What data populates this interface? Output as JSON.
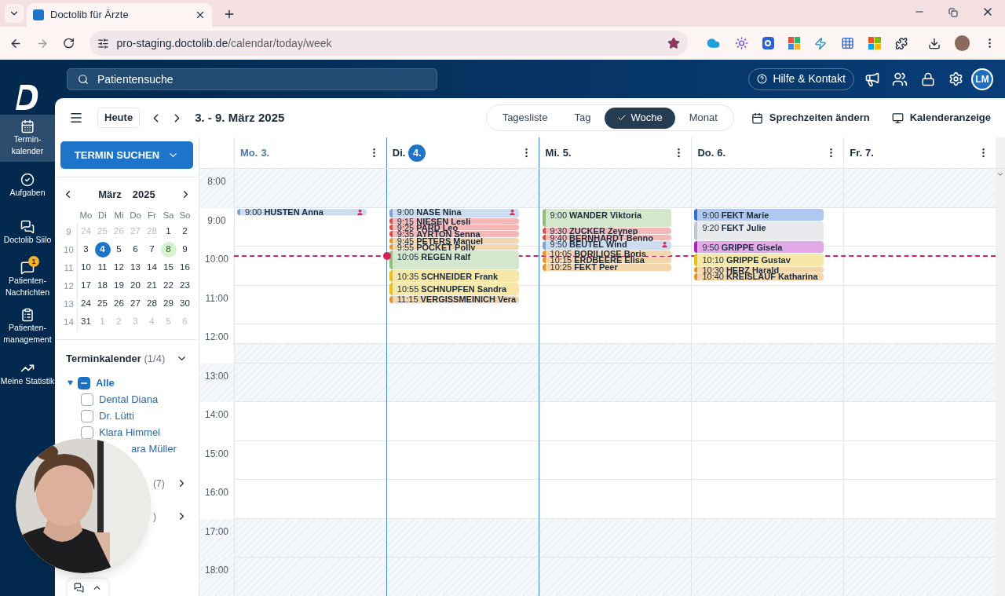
{
  "browser": {
    "tab_title": "Doctolib für Ärzte",
    "url_host": "pro-staging.doctolib.de",
    "url_path": "/calendar/today/week"
  },
  "header": {
    "search_placeholder": "Patientensuche",
    "help_button": "Hilfe & Kontakt",
    "avatar_initials": "LM"
  },
  "nav": [
    {
      "label": "Termin-\nkalender",
      "selected": true
    },
    {
      "label": "Aufgaben",
      "selected": false
    },
    {
      "label": "Doctolib Siilo",
      "selected": false
    },
    {
      "label": "Patienten-\nNachrichten",
      "selected": false,
      "badge": "1"
    },
    {
      "label": "Patienten-\nmanagement",
      "selected": false
    },
    {
      "label": "Meine Statistik",
      "selected": false
    }
  ],
  "toolbar": {
    "today_button": "Heute",
    "range": "3. - 9. März 2025",
    "views": [
      {
        "label": "Tagesliste",
        "selected": false
      },
      {
        "label": "Tag",
        "selected": false
      },
      {
        "label": "Woche",
        "selected": true
      },
      {
        "label": "Monat",
        "selected": false
      }
    ],
    "actions": [
      "Sprechzeiten ändern",
      "Kalenderanzeige"
    ]
  },
  "left_panel": {
    "search_button": "TERMIN SUCHEN",
    "mini_calendar": {
      "month": "März",
      "year": "2025",
      "weekdays": [
        "Mo",
        "Di",
        "Mi",
        "Do",
        "Fr",
        "Sa",
        "So"
      ],
      "weeks": [
        {
          "number": "9",
          "days": [
            {
              "t": "24",
              "muted": true,
              "selected": false,
              "marked": false
            },
            {
              "t": "25",
              "muted": true,
              "selected": false,
              "marked": false
            },
            {
              "t": "26",
              "muted": true,
              "selected": false,
              "marked": false
            },
            {
              "t": "27",
              "muted": true,
              "selected": false,
              "marked": false
            },
            {
              "t": "28",
              "muted": true,
              "selected": false,
              "marked": false
            },
            {
              "t": "1",
              "muted": false,
              "selected": false,
              "marked": false
            },
            {
              "t": "2",
              "muted": false,
              "selected": false,
              "marked": false
            }
          ]
        },
        {
          "number": "10",
          "days": [
            {
              "t": "3",
              "muted": false,
              "selected": false,
              "marked": false
            },
            {
              "t": "4",
              "muted": false,
              "selected": true,
              "marked": false
            },
            {
              "t": "5",
              "muted": false,
              "selected": false,
              "marked": false
            },
            {
              "t": "6",
              "muted": false,
              "selected": false,
              "marked": false
            },
            {
              "t": "7",
              "muted": false,
              "selected": false,
              "marked": false
            },
            {
              "t": "8",
              "muted": false,
              "selected": false,
              "marked": true
            },
            {
              "t": "9",
              "muted": false,
              "selected": false,
              "marked": false
            }
          ]
        },
        {
          "number": "11",
          "days": [
            {
              "t": "10",
              "muted": false,
              "selected": false,
              "marked": false
            },
            {
              "t": "11",
              "muted": false,
              "selected": false,
              "marked": false
            },
            {
              "t": "12",
              "muted": false,
              "selected": false,
              "marked": false
            },
            {
              "t": "13",
              "muted": false,
              "selected": false,
              "marked": false
            },
            {
              "t": "14",
              "muted": false,
              "selected": false,
              "marked": false
            },
            {
              "t": "15",
              "muted": false,
              "selected": false,
              "marked": false
            },
            {
              "t": "16",
              "muted": false,
              "selected": false,
              "marked": false
            }
          ]
        },
        {
          "number": "12",
          "days": [
            {
              "t": "17",
              "muted": false,
              "selected": false,
              "marked": false
            },
            {
              "t": "18",
              "muted": false,
              "selected": false,
              "marked": false
            },
            {
              "t": "19",
              "muted": false,
              "selected": false,
              "marked": false
            },
            {
              "t": "20",
              "muted": false,
              "selected": false,
              "marked": false
            },
            {
              "t": "21",
              "muted": false,
              "selected": false,
              "marked": false
            },
            {
              "t": "22",
              "muted": false,
              "selected": false,
              "marked": false
            },
            {
              "t": "23",
              "muted": false,
              "selected": false,
              "marked": false
            }
          ]
        },
        {
          "number": "13",
          "days": [
            {
              "t": "24",
              "muted": false,
              "selected": false,
              "marked": false
            },
            {
              "t": "25",
              "muted": false,
              "selected": false,
              "marked": false
            },
            {
              "t": "26",
              "muted": false,
              "selected": false,
              "marked": false
            },
            {
              "t": "27",
              "muted": false,
              "selected": false,
              "marked": false
            },
            {
              "t": "28",
              "muted": false,
              "selected": false,
              "marked": false
            },
            {
              "t": "29",
              "muted": false,
              "selected": false,
              "marked": false
            },
            {
              "t": "30",
              "muted": false,
              "selected": false,
              "marked": false
            }
          ]
        },
        {
          "number": "14",
          "days": [
            {
              "t": "31",
              "muted": false,
              "selected": false,
              "marked": false
            },
            {
              "t": "1",
              "muted": true,
              "selected": false,
              "marked": false
            },
            {
              "t": "2",
              "muted": true,
              "selected": false,
              "marked": false
            },
            {
              "t": "3",
              "muted": true,
              "selected": false,
              "marked": false
            },
            {
              "t": "4",
              "muted": true,
              "selected": false,
              "marked": false
            },
            {
              "t": "5",
              "muted": true,
              "selected": false,
              "marked": false
            },
            {
              "t": "6",
              "muted": true,
              "selected": false,
              "marked": false
            }
          ]
        }
      ]
    },
    "calendars": {
      "title": "Terminkalender",
      "count": "(1/4)",
      "expanded": true,
      "root": {
        "label": "Alle",
        "indeterminate": true,
        "expanded": true,
        "children": [
          {
            "label": "Dental Diana",
            "checked": false
          },
          {
            "label": "Dr. Lütti",
            "checked": false
          },
          {
            "label": "Klara Himmel",
            "checked": false
          }
        ]
      },
      "covered_item": "ara Müller"
    },
    "sections": [
      {
        "count": "(7)",
        "expanded": false
      },
      {
        "count": ")",
        "expanded": false
      }
    ]
  },
  "calendar": {
    "hours": [
      {
        "label": "8:00",
        "kind": "closed"
      },
      {
        "label": "9:00",
        "kind": "open"
      },
      {
        "label": "10:00",
        "kind": "open"
      },
      {
        "label": "11:00",
        "kind": "open"
      },
      {
        "label": "12:00",
        "kind": "halfclosed"
      },
      {
        "label": "13:00",
        "kind": "closed"
      },
      {
        "label": "14:00",
        "kind": "open"
      },
      {
        "label": "15:00",
        "kind": "open"
      },
      {
        "label": "16:00",
        "kind": "open"
      },
      {
        "label": "17:00",
        "kind": "closed"
      },
      {
        "label": "18:00",
        "kind": "closed"
      }
    ],
    "days": [
      {
        "label": "Mo.",
        "date": "3.",
        "today": false,
        "past": true,
        "events": [
          {
            "time": "9:00",
            "name": "HUSTEN Anna",
            "color": "#7fa3d6",
            "person_icon": true
          }
        ]
      },
      {
        "label": "Di.",
        "date": "4.",
        "today": true,
        "past": false,
        "events": [
          {
            "time": "9:00",
            "name": "NASE Nina",
            "color": "#7fa3d6",
            "person_icon": true
          },
          {
            "time": "9:15",
            "name": "NIESEN Lesli",
            "color": "#e04848",
            "person_icon": false
          },
          {
            "time": "9:25",
            "name": "PARD Leo",
            "color": "#e04848",
            "person_icon": false
          },
          {
            "time": "9:35",
            "name": "AYRTON Senna",
            "color": "#e04848",
            "person_icon": false
          },
          {
            "time": "9:45",
            "name": "PETERS Manuel",
            "color": "#e39425",
            "person_icon": false
          },
          {
            "time": "9:55",
            "name": "POCKET Polly",
            "color": "#e39425",
            "person_icon": false
          },
          {
            "time": "10:05",
            "name": "REGEN Ralf",
            "color": "#8fbf7a",
            "person_icon": false
          },
          {
            "time": "10:35",
            "name": "SCHNEIDER Frank",
            "color": "#e8c21a",
            "person_icon": false
          },
          {
            "time": "10:55",
            "name": "SCHNUPFEN Sandra",
            "color": "#e8c21a",
            "person_icon": false
          },
          {
            "time": "11:15",
            "name": "VERGISSMEINICH Vera",
            "color": "#e39425",
            "person_icon": false
          }
        ]
      },
      {
        "label": "Mi.",
        "date": "5.",
        "today": false,
        "past": false,
        "events": [
          {
            "time": "9:00",
            "name": "WANDER Viktoria",
            "color": "#8fbf7a",
            "person_icon": false
          },
          {
            "time": "9:30",
            "name": "ZUCKER Zeynep",
            "color": "#e04848",
            "person_icon": false
          },
          {
            "time": "9:40",
            "name": "BERNHARDT Benno",
            "color": "#e04848",
            "person_icon": false
          },
          {
            "time": "9:50",
            "name": "BEUTEL Wind",
            "color": "#7fa3d6",
            "person_icon": true
          },
          {
            "time": "10:05",
            "name": "BORILIOSE Boris",
            "color": "#e39425",
            "person_icon": false
          },
          {
            "time": "10:15",
            "name": "ERDBEERE Elisa",
            "color": "#e39425",
            "person_icon": false
          },
          {
            "time": "10:25",
            "name": "FEKT Peer",
            "color": "#e39425",
            "person_icon": false
          }
        ]
      },
      {
        "label": "Do.",
        "date": "6.",
        "today": false,
        "past": false,
        "events": [
          {
            "time": "9:00",
            "name": "FEKT Marie",
            "color": "#2f6fd6",
            "person_icon": false
          },
          {
            "time": "9:20",
            "name": "FEKT Julie",
            "color": "#c3c8d0",
            "person_icon": false
          },
          {
            "time": "9:50",
            "name": "GRIPPE Gisela",
            "color": "#b020c0",
            "person_icon": false
          },
          {
            "time": "10:10",
            "name": "GRIPPE Gustav",
            "color": "#e8c21a",
            "person_icon": false
          },
          {
            "time": "10:30",
            "name": "HERZ Harald",
            "color": "#e39425",
            "person_icon": false
          },
          {
            "time": "10:40",
            "name": "KREISLAUF Katharina",
            "color": "#e39425",
            "person_icon": false
          }
        ]
      },
      {
        "label": "Fr.",
        "date": "7.",
        "today": false,
        "past": false
      }
    ]
  }
}
